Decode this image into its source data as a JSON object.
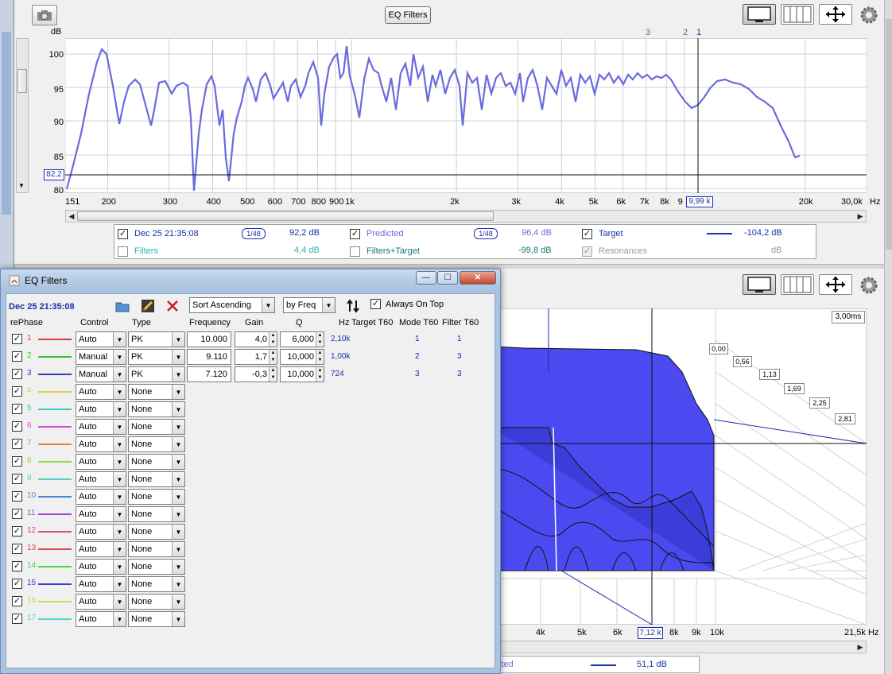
{
  "main_window": {
    "eq_filters_button": "EQ Filters",
    "graph_indicator_labels": [
      "3",
      "2",
      "1"
    ],
    "y_axis_unit": "dB",
    "y_ticks": [
      "100",
      "95",
      "90",
      "85",
      "80"
    ],
    "cursor_y_readout": "82,2",
    "x_ticks": [
      "151",
      "200",
      "300",
      "400",
      "500",
      "600",
      "700",
      "800",
      "900",
      "1k",
      "2k",
      "3k",
      "4k",
      "5k",
      "6k",
      "7k",
      "8k",
      "9",
      "20k",
      "30,0k"
    ],
    "cursor_x_readout": "9,99 k",
    "x_unit": "Hz"
  },
  "legend": {
    "row1": [
      {
        "label": "Dec 25 21:35:08",
        "checked": true,
        "smoothing": "1/48",
        "value": "92,2 dB",
        "color": "#1b2fa8"
      },
      {
        "label": "Predicted",
        "checked": true,
        "smoothing": "1/48",
        "value": "96,4 dB",
        "color": "#6a6adf"
      },
      {
        "label": "Target",
        "checked": true,
        "value": "-104,2 dB",
        "color": "#1b2fa8"
      }
    ],
    "row2": [
      {
        "label": "Filters",
        "checked": false,
        "value": "4,4 dB",
        "color": "#2eb3b3"
      },
      {
        "label": "Filters+Target",
        "checked": false,
        "value": "-99,8 dB",
        "color": "#177575"
      },
      {
        "label": "Resonances",
        "checked": true,
        "disabled": true,
        "value": "dB",
        "color": "#999999"
      }
    ]
  },
  "waterfall": {
    "z_labels": [
      "3,00ms",
      "0,00",
      "0,56",
      "1,13",
      "1,69",
      "2,25",
      "2,81"
    ],
    "x_ticks": [
      "4k",
      "5k",
      "6k",
      "7k",
      "8k",
      "9k",
      "10k",
      "21,5k Hz"
    ],
    "cursor_x_readout": "7,12 k",
    "bottom_legend_partial": "cted",
    "bottom_legend_value": "51,1 dB"
  },
  "eq_dialog": {
    "title": "EQ Filters",
    "measurement": "Dec 25 21:35:08",
    "sort_select": "Sort Ascending",
    "by_select": "by Freq",
    "always_on_top_label": "Always On Top",
    "headers": {
      "rephase": "rePhase",
      "control": "Control",
      "type": "Type",
      "frequency": "Frequency",
      "gain": "Gain",
      "q": "Q",
      "hz": "Hz",
      "target_t60": "Target T60",
      "mode_t60": "Mode T60",
      "filter_t60": "Filter T60"
    },
    "filters": [
      {
        "num": "1",
        "color": "#d83a3a",
        "control": "Auto",
        "type": "PK",
        "freq": "10.000",
        "gain": "4,0",
        "q": "6,000",
        "hz": "2,10k",
        "mode": "1",
        "filter": "1"
      },
      {
        "num": "2",
        "color": "#3bbf3b",
        "control": "Manual",
        "type": "PK",
        "freq": "9.110",
        "gain": "1,7",
        "q": "10,000",
        "hz": "1,00k",
        "mode": "2",
        "filter": "3"
      },
      {
        "num": "3",
        "color": "#2f3fbf",
        "control": "Manual",
        "type": "PK",
        "freq": "7.120",
        "gain": "-0,3",
        "q": "10,000",
        "hz": "724",
        "mode": "3",
        "filter": "3"
      },
      {
        "num": "4",
        "color": "#d6cf4a",
        "control": "Auto",
        "type": "None"
      },
      {
        "num": "5",
        "color": "#38c7c7",
        "control": "Auto",
        "type": "None"
      },
      {
        "num": "6",
        "color": "#d14fd1",
        "control": "Auto",
        "type": "None"
      },
      {
        "num": "7",
        "color": "#d58a3a",
        "control": "Auto",
        "type": "None"
      },
      {
        "num": "8",
        "color": "#8fd94a",
        "control": "Auto",
        "type": "None"
      },
      {
        "num": "9",
        "color": "#4ad1c1",
        "control": "Auto",
        "type": "None"
      },
      {
        "num": "10",
        "color": "#4a86d6",
        "control": "Auto",
        "type": "None"
      },
      {
        "num": "11",
        "color": "#9a4ad6",
        "control": "Auto",
        "type": "None"
      },
      {
        "num": "12",
        "color": "#d64a8a",
        "control": "Auto",
        "type": "None"
      },
      {
        "num": "13",
        "color": "#d64a4a",
        "control": "Auto",
        "type": "None"
      },
      {
        "num": "14",
        "color": "#4ad64a",
        "control": "Auto",
        "type": "None"
      },
      {
        "num": "15",
        "color": "#3a3ad6",
        "control": "Auto",
        "type": "None"
      },
      {
        "num": "16",
        "color": "#d6d64a",
        "control": "Auto",
        "type": "None"
      },
      {
        "num": "17",
        "color": "#4ad6d6",
        "control": "Auto",
        "type": "None"
      }
    ]
  }
}
